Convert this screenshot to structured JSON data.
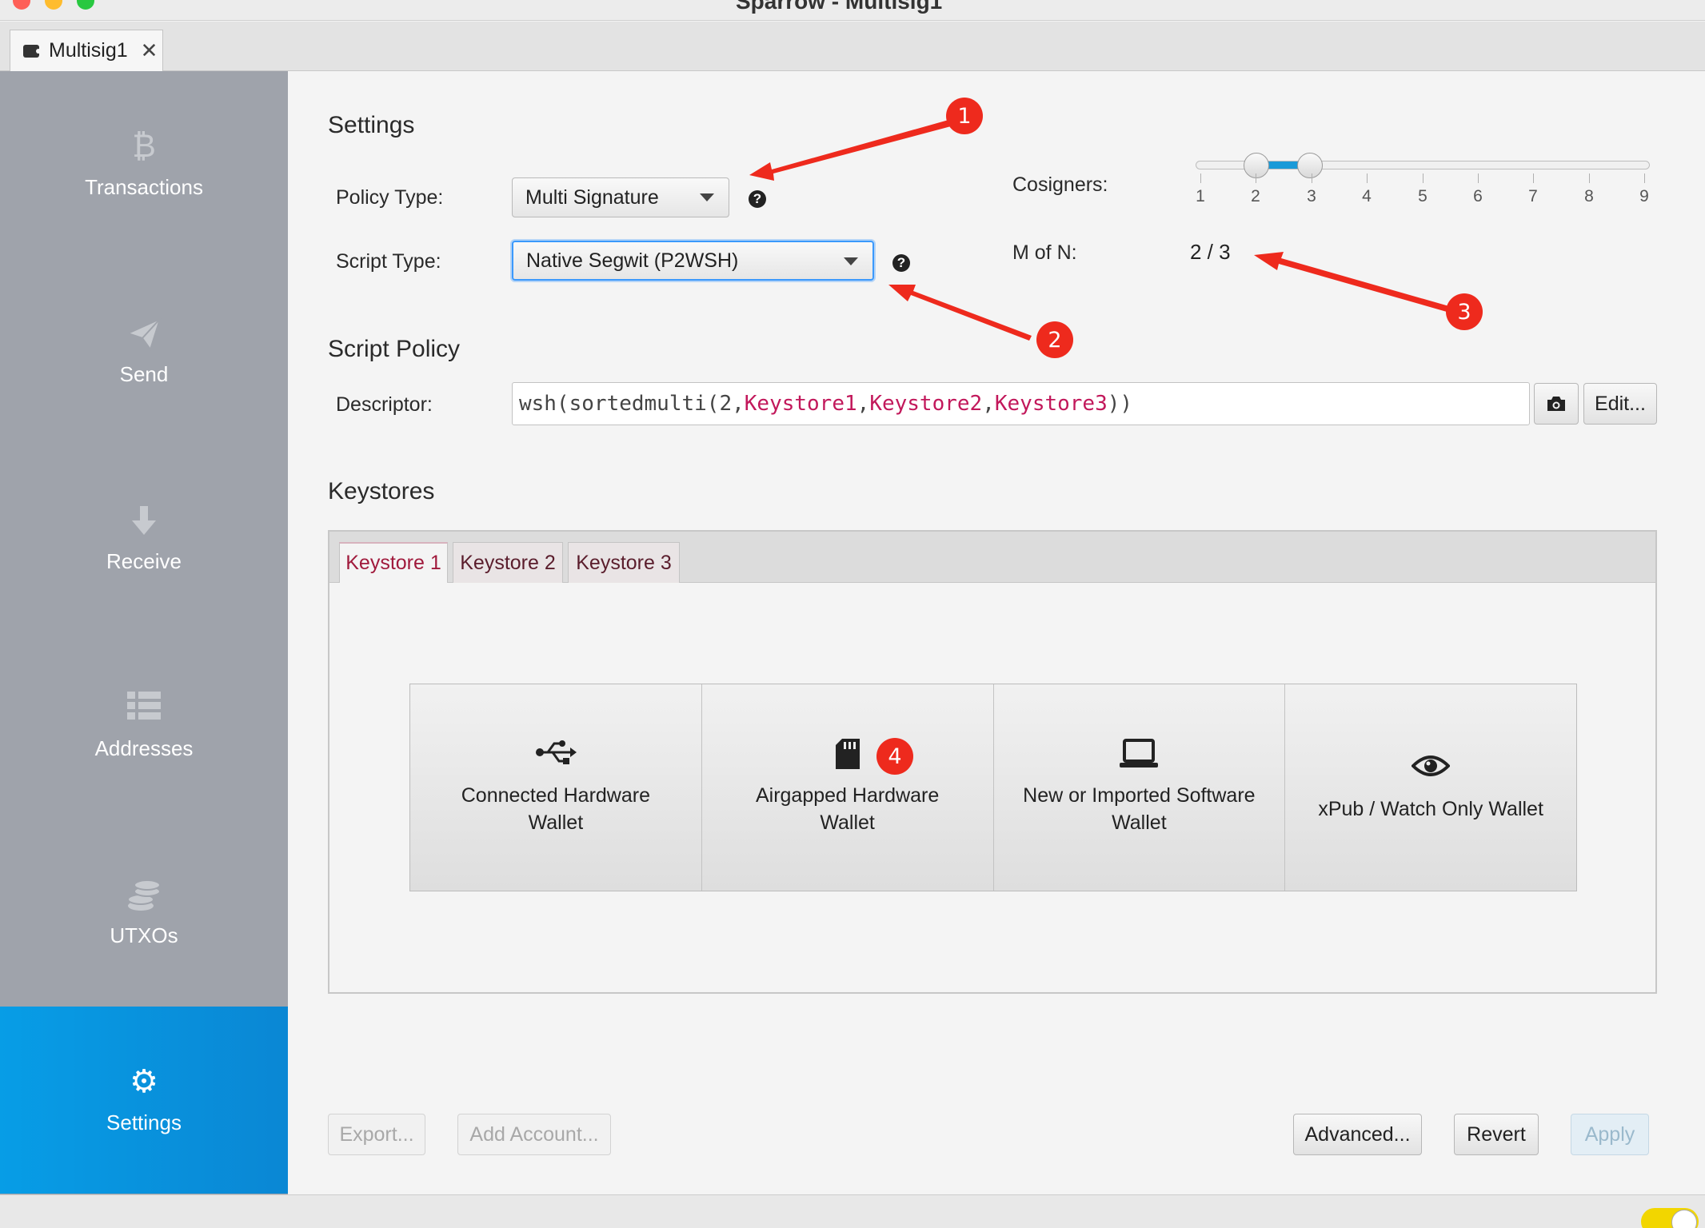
{
  "window": {
    "title": "Sparrow - Multisig1"
  },
  "doc_tab": {
    "label": "Multisig1"
  },
  "sidebar": {
    "items": [
      {
        "label": "Transactions",
        "icon": "bitcoin-icon"
      },
      {
        "label": "Send",
        "icon": "paper-plane-icon"
      },
      {
        "label": "Receive",
        "icon": "arrow-down-icon"
      },
      {
        "label": "Addresses",
        "icon": "list-icon"
      },
      {
        "label": "UTXOs",
        "icon": "coins-icon"
      },
      {
        "label": "Settings",
        "icon": "gear-icon",
        "active": true
      }
    ]
  },
  "settings": {
    "title": "Settings",
    "policy_type_label": "Policy Type:",
    "policy_type_value": "Multi Signature",
    "script_type_label": "Script Type:",
    "script_type_value": "Native Segwit (P2WSH)",
    "cosigners_label": "Cosigners:",
    "cosigners_ticks": [
      "1",
      "2",
      "3",
      "4",
      "5",
      "6",
      "7",
      "8",
      "9"
    ],
    "cosigners_range": [
      2,
      3
    ],
    "m_of_n_label": "M of N:",
    "m_of_n_value": "2 / 3"
  },
  "script_policy": {
    "title": "Script Policy",
    "descriptor_label": "Descriptor:",
    "descriptor_prefix": "wsh(sortedmulti(2,",
    "keystores": [
      "Keystore1",
      "Keystore2",
      "Keystore3"
    ],
    "descriptor_sep": ",",
    "descriptor_suffix": "))",
    "edit_label": "Edit..."
  },
  "keystores": {
    "title": "Keystores",
    "tabs": [
      "Keystore 1",
      "Keystore 2",
      "Keystore 3"
    ],
    "options": [
      {
        "line1": "Connected Hardware",
        "line2": "Wallet",
        "icon": "usb-icon"
      },
      {
        "line1": "Airgapped Hardware",
        "line2": "Wallet",
        "icon": "sd-card-icon"
      },
      {
        "line1": "New or Imported Software",
        "line2": "Wallet",
        "icon": "laptop-icon"
      },
      {
        "line1": "xPub / Watch Only Wallet",
        "line2": "",
        "icon": "eye-icon"
      }
    ]
  },
  "footer": {
    "export_label": "Export...",
    "add_account_label": "Add Account...",
    "advanced_label": "Advanced...",
    "revert_label": "Revert",
    "apply_label": "Apply"
  },
  "annotations": {
    "badges": [
      "1",
      "2",
      "3",
      "4"
    ],
    "color": "#ee2a1d"
  },
  "colors": {
    "accent": "#0a96dc",
    "keystore_text": "#c2185b"
  }
}
